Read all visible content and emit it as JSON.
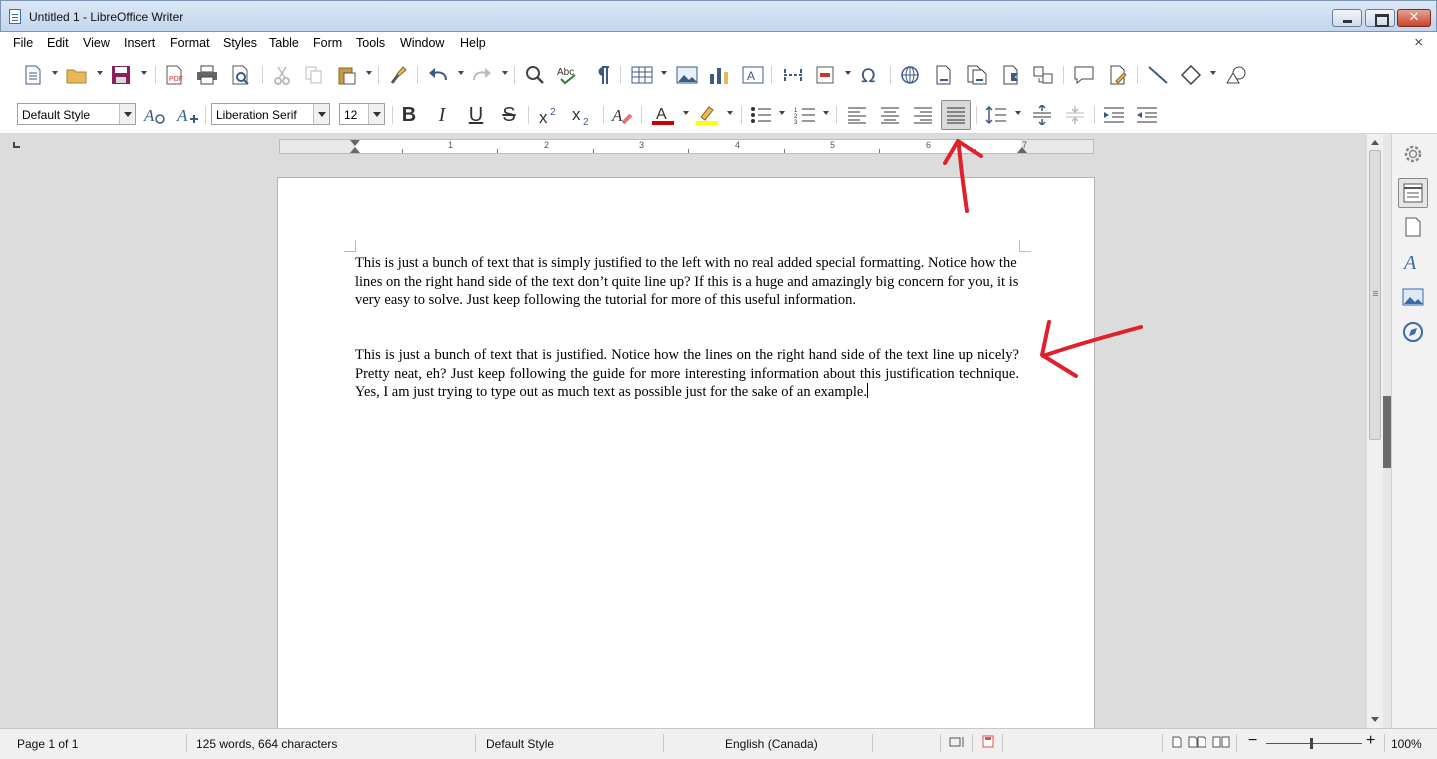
{
  "window": {
    "title": "Untitled 1 - LibreOffice Writer",
    "close_glyph": "✕"
  },
  "menu": [
    "File",
    "Edit",
    "View",
    "Insert",
    "Format",
    "Styles",
    "Table",
    "Form",
    "Tools",
    "Window",
    "Help"
  ],
  "menu_close_glyph": "×",
  "formatting": {
    "paragraph_style": "Default Style",
    "font_name": "Liberation Serif",
    "font_size": "12",
    "bold": "B",
    "italic": "I",
    "underline": "U",
    "strike": "S",
    "active_alignment": "justified",
    "font_color": "#cc0000",
    "highlight_color": "#ffff00"
  },
  "ruler": {
    "numbers": [
      "1",
      "2",
      "3",
      "4",
      "5",
      "6",
      "7"
    ]
  },
  "document": {
    "paragraphs": [
      "This is just a bunch of text that is simply justified to the left with no real added special formatting.  Notice how the lines on the right hand side of the text don’t quite line up?  If this is a huge and amazingly big concern for you, it is very easy to solve.  Just keep following the tutorial for more of this useful information.",
      "This is just a bunch of text that is justified.  Notice how the lines on the right hand side of the text line up nicely?  Pretty neat, eh?  Just keep following the guide for more interesting information about this justification technique.  Yes, I am just trying to type out as much text as possible just for the sake of an example."
    ]
  },
  "status": {
    "page": "Page 1 of 1",
    "word_count": "125 words, 664 characters",
    "page_style": "Default Style",
    "language": "English (Canada)",
    "zoom": "100%",
    "zoom_level": 1.0
  },
  "annotation_color": "#e0202a"
}
